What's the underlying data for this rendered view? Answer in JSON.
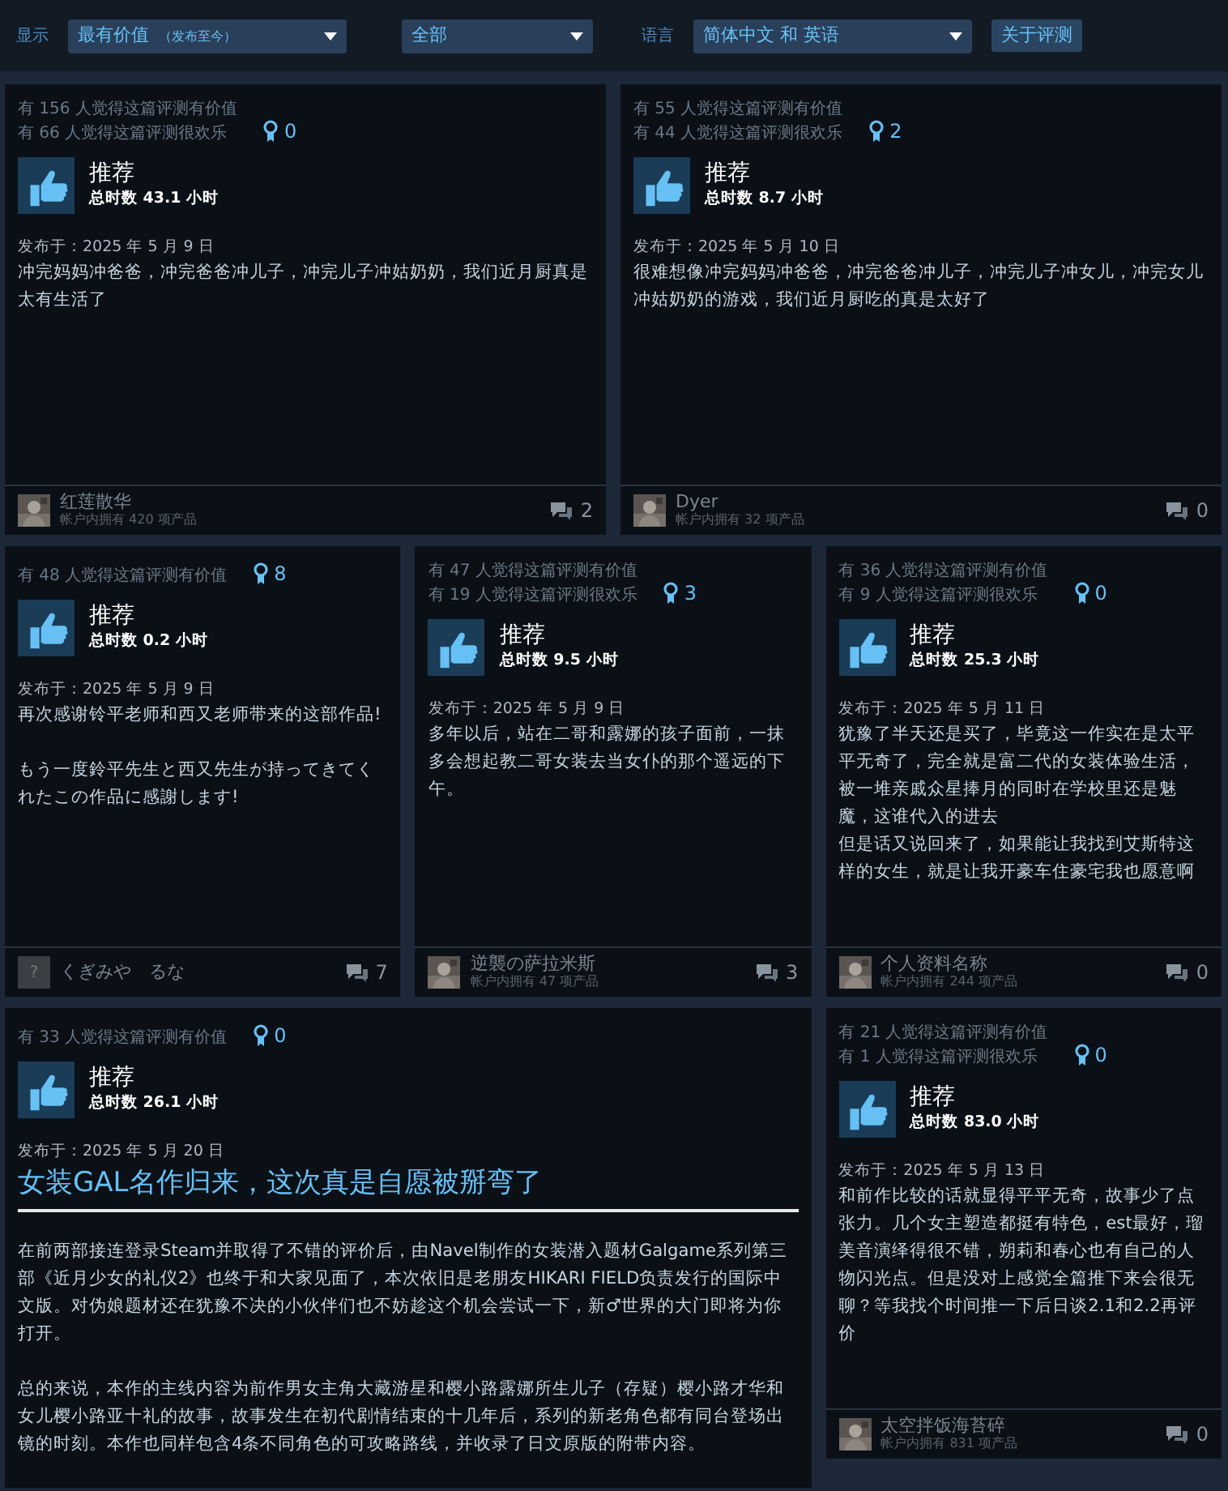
{
  "toolbar": {
    "display_label": "显示",
    "sort": {
      "value": "最有价值",
      "note": "（发布至今）"
    },
    "type_filter": {
      "value": "全部"
    },
    "language_label": "语言",
    "language": {
      "value": "简体中文 和 英语"
    },
    "about_button": "关于评测"
  },
  "rows": [
    [
      {
        "kind": "standard",
        "helpful": "有 156 人觉得这篇评测有价值",
        "funny": "有 66 人觉得这篇评测很欢乐",
        "awards": "0",
        "verdict": "推荐",
        "hours": "总时数 43.1 小时",
        "date": "发布于：2025 年 5 月 9 日",
        "paragraphs": [
          "冲完妈妈冲爸爸，冲完爸爸冲儿子，冲完儿子冲姑奶奶，我们近月厨真是太有生活了"
        ],
        "author": {
          "name": "红莲散华",
          "products": "帐户内拥有 420 项产品"
        },
        "comments": "2"
      },
      {
        "kind": "standard",
        "helpful": "有 55 人觉得这篇评测有价值",
        "funny": "有 44 人觉得这篇评测很欢乐",
        "awards": "2",
        "verdict": "推荐",
        "hours": "总时数 8.7 小时",
        "date": "发布于：2025 年 5 月 10 日",
        "paragraphs": [
          "很难想像冲完妈妈冲爸爸，冲完爸爸冲儿子，冲完儿子冲女儿，冲完女儿冲姑奶奶的游戏，我们近月厨吃的真是太好了"
        ],
        "author": {
          "name": "Dyer",
          "products": "帐户内拥有 32 项产品"
        },
        "comments": "0"
      }
    ],
    [
      {
        "kind": "standard",
        "helpful": "有 48 人觉得这篇评测有价值",
        "awards": "8",
        "verdict": "推荐",
        "hours": "总时数 0.2 小时",
        "date": "发布于：2025 年 5 月 9 日",
        "paragraphs": [
          "再次感谢铃平老师和西又老师带来的这部作品!",
          "もう一度鈴平先生と西又先生が持ってきてくれたこの作品に感謝します!"
        ],
        "author": {
          "name": "くぎみや　るな",
          "avatar": {
            "kind": "placeholder",
            "glyph": "?"
          }
        },
        "comments": "7"
      },
      {
        "kind": "standard",
        "helpful": "有 47 人觉得这篇评测有价值",
        "funny": "有 19 人觉得这篇评测很欢乐",
        "awards": "3",
        "verdict": "推荐",
        "hours": "总时数 9.5 小时",
        "date": "发布于：2025 年 5 月 9 日",
        "paragraphs": [
          "多年以后，站在二哥和露娜的孩子面前，一抹多会想起教二哥女装去当女仆的那个遥远的下午。"
        ],
        "author": {
          "name": "逆襲の萨拉米斯",
          "products": "帐户内拥有 47 项产品"
        },
        "comments": "3"
      },
      {
        "kind": "standard",
        "helpful": "有 36 人觉得这篇评测有价值",
        "funny": "有 9 人觉得这篇评测很欢乐",
        "awards": "0",
        "verdict": "推荐",
        "hours": "总时数 25.3 小时",
        "date": "发布于：2025 年 5 月 11 日",
        "paragraphs": [
          [
            "犹豫了半天还是买了，毕竟这一作实在是太平平无奇了，完全就是富二代的女装体验生活，被一堆亲戚众星捧月的同时在学校里还是魅魔，这谁代入的进去",
            "但是话又说回来了，如果能让我找到艾斯特这样的女生，就是让我开豪车住豪宅我也愿意啊"
          ]
        ],
        "author": {
          "name": "个人资料名称",
          "products": "帐户内拥有 244 项产品"
        },
        "comments": "0"
      }
    ],
    [
      {
        "kind": "featured",
        "helpful": "有 33 人觉得这篇评测有价值",
        "awards": "0",
        "verdict": "推荐",
        "hours": "总时数 26.1 小时",
        "date": "发布于：2025 年 5 月 20 日",
        "title": "女装GAL名作归来，这次真是自愿被掰弯了",
        "paragraphs": [
          "在前两部接连登录Steam并取得了不错的评价后，由Navel制作的女装潜入题材Galgame系列第三部《近月少女的礼仪2》也终于和大家见面了，本次依旧是老朋友HIKARI FIELD负责发行的国际中文版。对伪娘题材还在犹豫不决的小伙伴们也不妨趁这个机会尝试一下，新♂世界的大门即将为你打开。",
          "总的来说，本作的主线内容为前作男女主角大藏游星和樱小路露娜所生儿子（存疑）樱小路才华和女儿樱小路亚十礼的故事，故事发生在初代剧情结束的十几年后，系列的新老角色都有同台登场出镜的时刻。本作也同样包含4条不同角色的可攻略路线，并收录了日文原版的附带内容。"
        ]
      },
      {
        "kind": "standard",
        "helpful": "有 21 人觉得这篇评测有价值",
        "funny": "有 1 人觉得这篇评测很欢乐",
        "awards": "0",
        "verdict": "推荐",
        "hours": "总时数 83.0 小时",
        "date": "发布于：2025 年 5 月 13 日",
        "paragraphs": [
          "和前作比较的话就显得平平无奇，故事少了点张力。几个女主塑造都挺有特色，est最好，瑠美音演绎得很不错，朔莉和春心也有自己的人物闪光点。但是没对上感觉全篇推下来会很无聊？等我找个时间推一下后日谈2.1和2.2再评价"
        ],
        "author": {
          "name": "太空拌饭海苔碎",
          "products": "帐户内拥有 831 项产品"
        },
        "comments": "0"
      }
    ]
  ]
}
